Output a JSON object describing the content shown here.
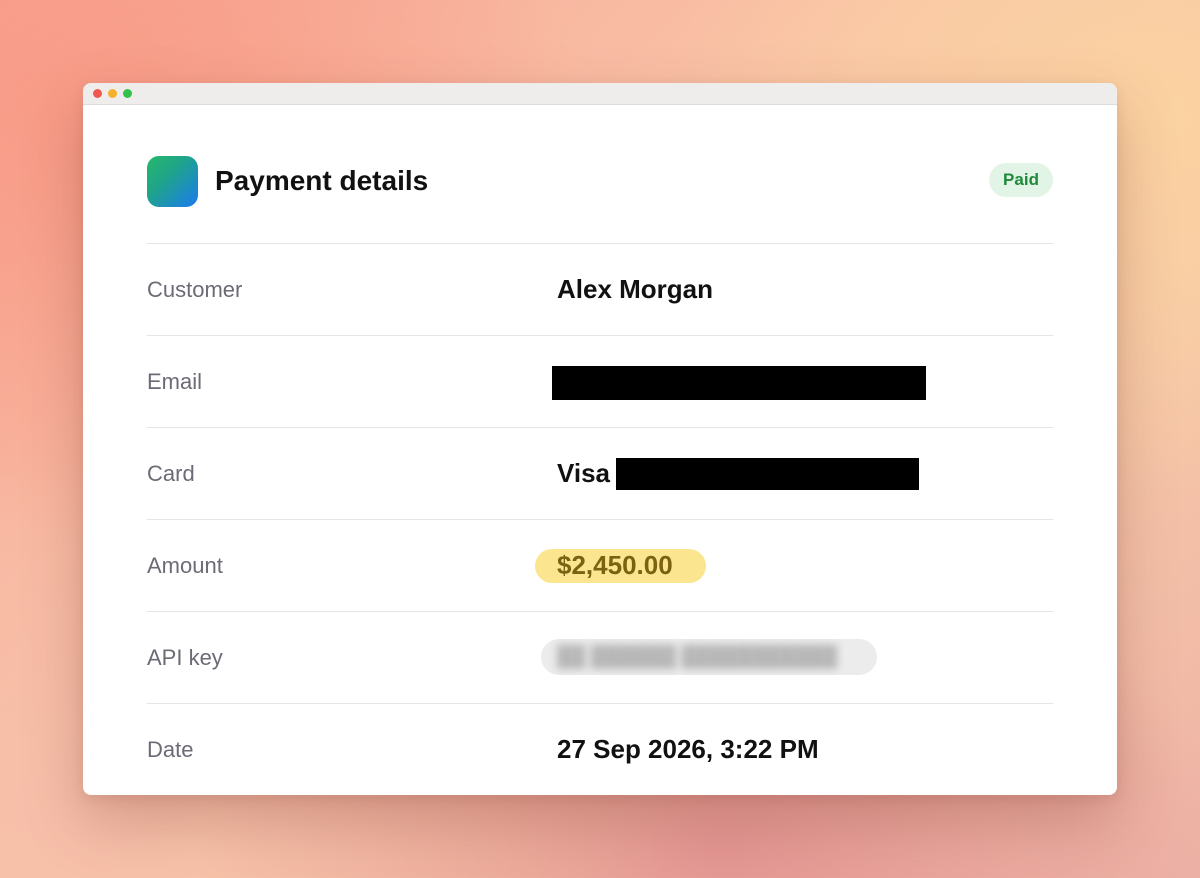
{
  "window": {
    "controls": [
      "close",
      "minimize",
      "zoom"
    ]
  },
  "header": {
    "icon": "app-icon",
    "title": "Payment details",
    "status_badge": "Paid",
    "status_color": "#1f8a3c"
  },
  "details": {
    "customer": {
      "label": "Customer",
      "value": "Alex Morgan"
    },
    "email": {
      "label": "Email",
      "value": ""
    },
    "card": {
      "label": "Card",
      "brand": "Visa",
      "value": ""
    },
    "amount": {
      "label": "Amount",
      "value": "$2,450.00",
      "highlight_color": "#fbe58f"
    },
    "api_key": {
      "label": "API key",
      "value": ""
    },
    "date": {
      "label": "Date",
      "value": "27 Sep 2026, 3:22 PM"
    }
  }
}
